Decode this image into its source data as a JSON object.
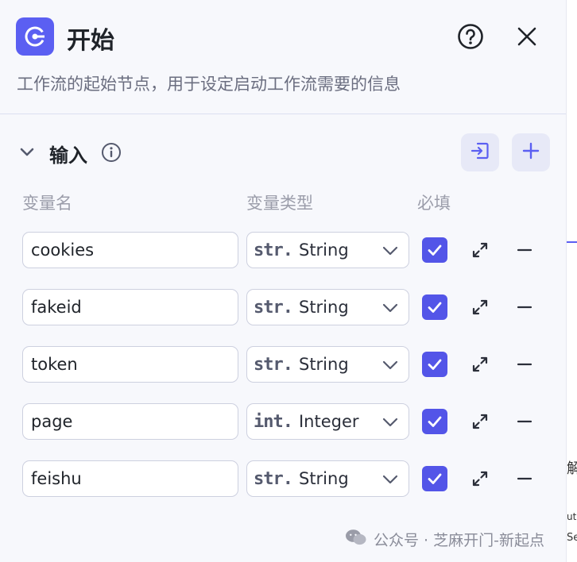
{
  "header": {
    "title": "开始",
    "subtitle": "工作流的起始节点，用于设定启动工作流需要的信息"
  },
  "section": {
    "title": "输入"
  },
  "columns": {
    "name": "变量名",
    "type": "变量类型",
    "required": "必填"
  },
  "variables": [
    {
      "name": "cookies",
      "type_prefix": "str.",
      "type": "String",
      "required": true
    },
    {
      "name": "fakeid",
      "type_prefix": "str.",
      "type": "String",
      "required": true
    },
    {
      "name": "token",
      "type_prefix": "str.",
      "type": "String",
      "required": true
    },
    {
      "name": "page",
      "type_prefix": "int.",
      "type": "Integer",
      "required": true
    },
    {
      "name": "feishu",
      "type_prefix": "str.",
      "type": "String",
      "required": true
    }
  ],
  "watermark": "公众号 · 芝麻开门-新起点",
  "edge": {
    "glyph_1": "解",
    "glyph_2": "ut",
    "glyph_3": "Se"
  },
  "colors": {
    "accent": "#5b5ff2",
    "checkbox": "#5355e8",
    "background": "#f7f8fc",
    "border": "#cdd0df"
  },
  "icons": {
    "app": "start-node-icon",
    "help": "question-circle-icon",
    "close": "close-icon",
    "collapse": "chevron-down-icon",
    "info": "info-icon",
    "import": "import-icon",
    "add": "plus-icon",
    "expand": "expand-icon",
    "remove": "minus-icon"
  }
}
